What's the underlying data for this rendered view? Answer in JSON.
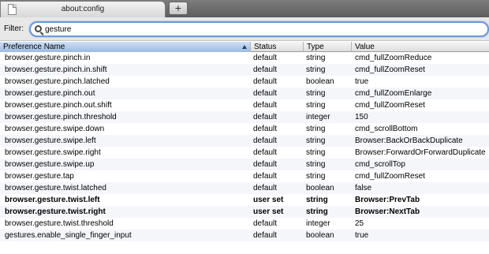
{
  "tab": {
    "title": "about:config",
    "new_tab_label": "+"
  },
  "filter": {
    "label": "Filter:",
    "value": "gesture"
  },
  "columns": {
    "name": "Preference Name",
    "status": "Status",
    "type": "Type",
    "value": "Value"
  },
  "rows": [
    {
      "name": "browser.gesture.pinch.in",
      "status": "default",
      "type": "string",
      "value": "cmd_fullZoomReduce",
      "user_set": false
    },
    {
      "name": "browser.gesture.pinch.in.shift",
      "status": "default",
      "type": "string",
      "value": "cmd_fullZoomReset",
      "user_set": false
    },
    {
      "name": "browser.gesture.pinch.latched",
      "status": "default",
      "type": "boolean",
      "value": "true",
      "user_set": false
    },
    {
      "name": "browser.gesture.pinch.out",
      "status": "default",
      "type": "string",
      "value": "cmd_fullZoomEnlarge",
      "user_set": false
    },
    {
      "name": "browser.gesture.pinch.out.shift",
      "status": "default",
      "type": "string",
      "value": "cmd_fullZoomReset",
      "user_set": false
    },
    {
      "name": "browser.gesture.pinch.threshold",
      "status": "default",
      "type": "integer",
      "value": "150",
      "user_set": false
    },
    {
      "name": "browser.gesture.swipe.down",
      "status": "default",
      "type": "string",
      "value": "cmd_scrollBottom",
      "user_set": false
    },
    {
      "name": "browser.gesture.swipe.left",
      "status": "default",
      "type": "string",
      "value": "Browser:BackOrBackDuplicate",
      "user_set": false
    },
    {
      "name": "browser.gesture.swipe.right",
      "status": "default",
      "type": "string",
      "value": "Browser:ForwardOrForwardDuplicate",
      "user_set": false
    },
    {
      "name": "browser.gesture.swipe.up",
      "status": "default",
      "type": "string",
      "value": "cmd_scrollTop",
      "user_set": false
    },
    {
      "name": "browser.gesture.tap",
      "status": "default",
      "type": "string",
      "value": "cmd_fullZoomReset",
      "user_set": false
    },
    {
      "name": "browser.gesture.twist.latched",
      "status": "default",
      "type": "boolean",
      "value": "false",
      "user_set": false
    },
    {
      "name": "browser.gesture.twist.left",
      "status": "user set",
      "type": "string",
      "value": "Browser:PrevTab",
      "user_set": true
    },
    {
      "name": "browser.gesture.twist.right",
      "status": "user set",
      "type": "string",
      "value": "Browser:NextTab",
      "user_set": true
    },
    {
      "name": "browser.gesture.twist.threshold",
      "status": "default",
      "type": "integer",
      "value": "25",
      "user_set": false
    },
    {
      "name": "gestures.enable_single_finger_input",
      "status": "default",
      "type": "boolean",
      "value": "true",
      "user_set": false
    }
  ]
}
